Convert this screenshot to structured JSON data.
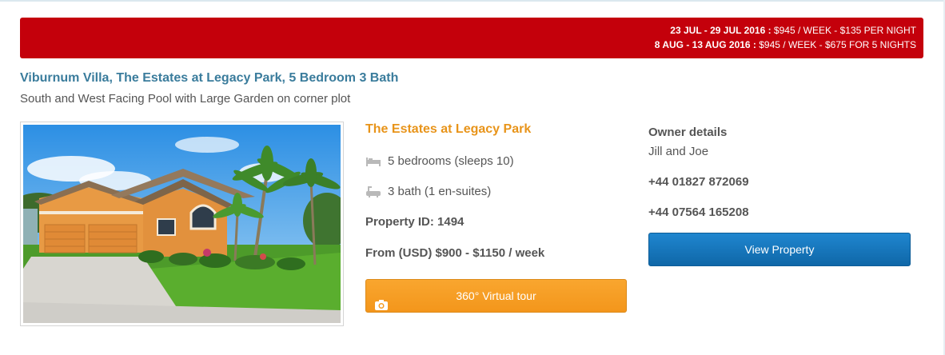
{
  "offers": [
    {
      "dates": "23 JUL - 29 JUL 2016 :",
      "price": " $945 / WEEK - $135 PER NIGHT"
    },
    {
      "dates": "8 AUG - 13 AUG 2016 :",
      "price": " $945 / WEEK - $675 FOR 5 NIGHTS"
    }
  ],
  "listing": {
    "title": "Viburnum Villa, The Estates at Legacy Park, 5 Bedroom 3 Bath",
    "subtitle": "South and West Facing Pool with Large Garden on corner plot"
  },
  "details": {
    "resort": "The Estates at Legacy Park",
    "bedrooms": "5 bedrooms (sleeps 10)",
    "baths": "3 bath (1 en-suites)",
    "property_id": "Property ID: 1494",
    "price": "From (USD) $900 - $1150 / week",
    "virtual_tour_label": "360° Virtual tour"
  },
  "owner": {
    "heading": "Owner details",
    "names": "Jill and Joe",
    "phone1": "+44 01827 872069",
    "phone2": "+44 07564 165208",
    "view_label": "View Property"
  },
  "icons": {
    "bed": "bed-icon",
    "bath": "bath-icon",
    "camera": "camera-icon"
  },
  "colors": {
    "offer_banner": "#c4000b",
    "title": "#3a7c9c",
    "resort": "#e8941a",
    "tour_button": "#f59b22",
    "view_button": "#1473b9"
  }
}
